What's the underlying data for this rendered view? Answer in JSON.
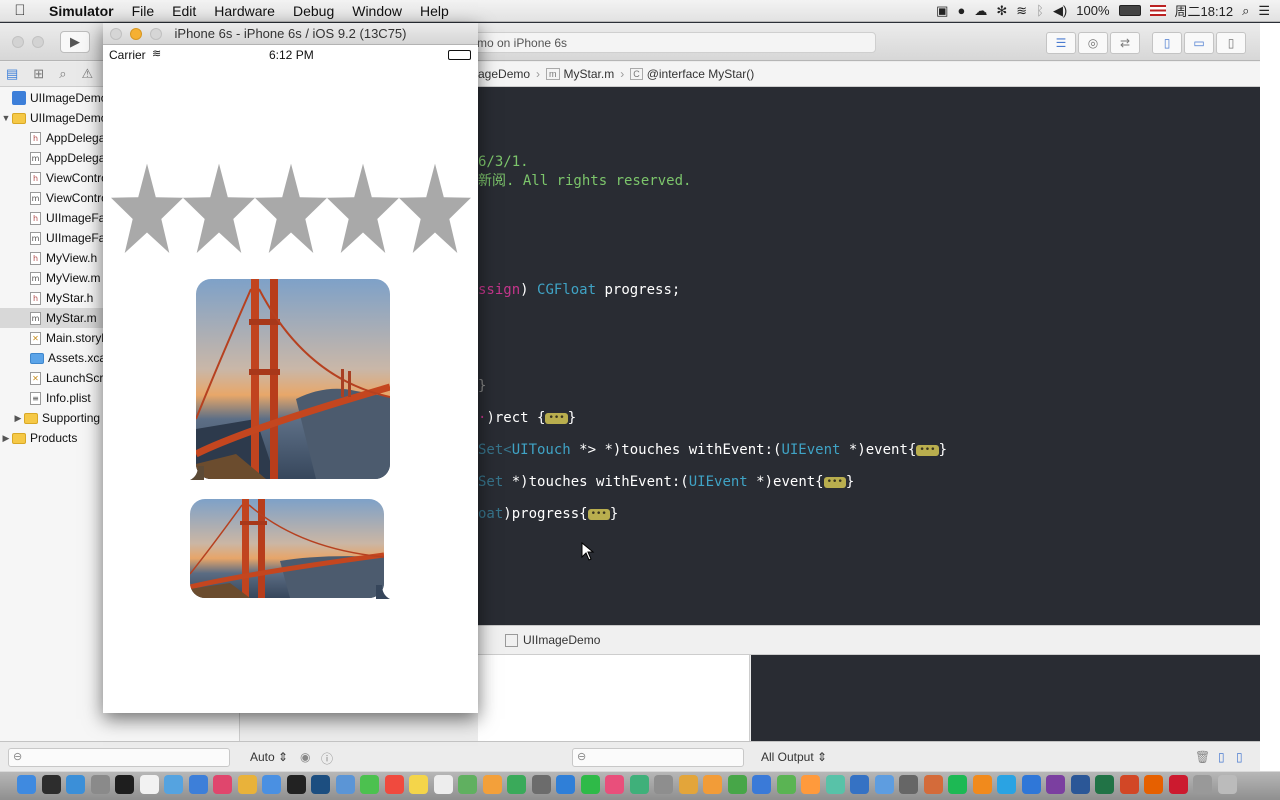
{
  "menubar": {
    "apple": "",
    "items": [
      "Simulator",
      "File",
      "Edit",
      "Hardware",
      "Debug",
      "Window",
      "Help"
    ],
    "battery": "100%",
    "clock": "周二18:12"
  },
  "xcode": {
    "activity_text": "mo on iPhone 6s",
    "jump_bar": [
      "ageDemo",
      "MyStar.m",
      "@interface MyStar()"
    ],
    "navigator": [
      {
        "label": "UIImageDemo",
        "kind": "project",
        "depth": 0
      },
      {
        "label": "UIImageDemo",
        "kind": "folder",
        "depth": 0,
        "expanded": true
      },
      {
        "label": "AppDelega",
        "kind": "h",
        "depth": 1
      },
      {
        "label": "AppDelega",
        "kind": "m",
        "depth": 1
      },
      {
        "label": "ViewContro",
        "kind": "h",
        "depth": 1
      },
      {
        "label": "ViewContro",
        "kind": "m",
        "depth": 1
      },
      {
        "label": "UIImageFa",
        "kind": "h",
        "depth": 1
      },
      {
        "label": "UIImageFa",
        "kind": "m",
        "depth": 1
      },
      {
        "label": "MyView.h",
        "kind": "h",
        "depth": 1
      },
      {
        "label": "MyView.m",
        "kind": "m",
        "depth": 1
      },
      {
        "label": "MyStar.h",
        "kind": "h",
        "depth": 1
      },
      {
        "label": "MyStar.m",
        "kind": "m",
        "depth": 1,
        "selected": true
      },
      {
        "label": "Main.storyb",
        "kind": "sb",
        "depth": 1
      },
      {
        "label": "Assets.xca",
        "kind": "bluefolder",
        "depth": 1
      },
      {
        "label": "LaunchScre",
        "kind": "sb",
        "depth": 1
      },
      {
        "label": "Info.plist",
        "kind": "plist",
        "depth": 1
      },
      {
        "label": "Supporting",
        "kind": "folder",
        "depth": 1,
        "collapsed": true
      },
      {
        "label": "Products",
        "kind": "folder",
        "depth": 0,
        "collapsed": true
      }
    ],
    "code_lines": {
      "l1": "6/3/1.",
      "l2": "新阅. All rights reserved.",
      "l3a": "ssign",
      "l3b": ") ",
      "l3c": "CGFloat",
      "l3d": " progress;",
      "l4": "}",
      "l5": ")rect {",
      "l6a": "Set<",
      "l6b": "UITouch",
      "l6c": " *> *)touches withEvent:(",
      "l6d": "UIEvent",
      "l6e": " *)event{",
      "l7a": "Set",
      "l7b": " *)touches withEvent:(",
      "l7c": "UIEvent",
      "l7d": " *)event{",
      "l8a": "oat",
      "l8b": ")progress{",
      "l8c": "}"
    },
    "fold_marker": "•••",
    "debug_target": "UIImageDemo",
    "auto_label": "Auto",
    "all_output_label": "All Output"
  },
  "simulator": {
    "title": "iPhone 6s - iPhone 6s / iOS 9.2 (13C75)",
    "carrier": "Carrier",
    "time": "6:12 PM",
    "rating": {
      "filled": 5,
      "max": 5,
      "color": "#a9a9a9"
    },
    "photos": [
      "golden-gate-bridge-photo",
      "golden-gate-bridge-photo-wide"
    ]
  },
  "colors": {
    "editor_bg": "#292c33",
    "comment": "#7cc56b",
    "keyword": "#c5358c",
    "type": "#3fa3c5",
    "star": "#a9a9a9"
  },
  "dock": {
    "icons": [
      "finder",
      "launchpad",
      "safari",
      "preferences",
      "terminal",
      "textedit",
      "preview",
      "appstore",
      "itunes",
      "chrome",
      "xcode",
      "github",
      "photoshop",
      "mail",
      "messages",
      "calendar",
      "notes",
      "reminders",
      "maps",
      "photos",
      "facetime",
      "instruments",
      "qq",
      "wechat",
      "music",
      "gif",
      "dash",
      "sketch",
      "pages",
      "numbers",
      "keynote",
      "evernote",
      "sublime",
      "atom",
      "sourcetree",
      "charles",
      "kaleidoscope",
      "transmit",
      "spotify",
      "vlc",
      "skype",
      "dropbox",
      "onenote",
      "word",
      "excel",
      "powerpoint",
      "firefox",
      "opera",
      "calculator",
      "trash"
    ]
  }
}
